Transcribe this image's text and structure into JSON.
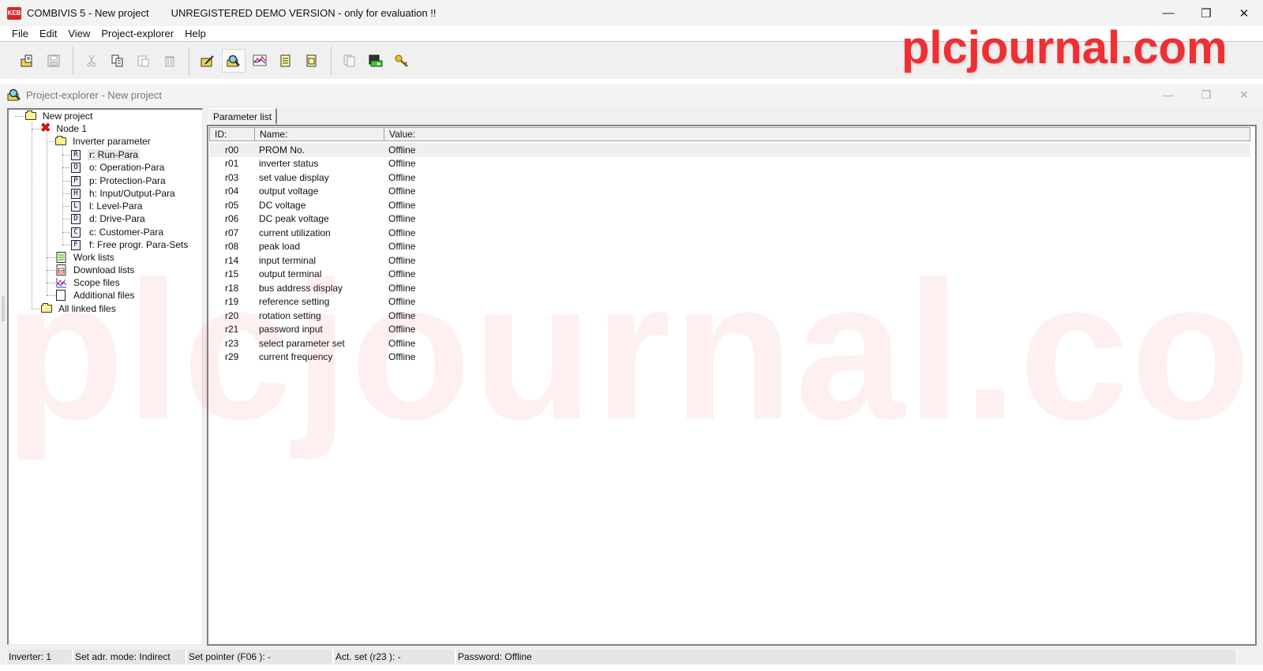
{
  "titlebar": {
    "logo": "KEB",
    "title": "COMBIVIS 5 - New project",
    "demo_notice": "UNREGISTERED DEMO VERSION - only for evaluation !!",
    "minimize": "—",
    "restore": "❐",
    "close": "✕"
  },
  "menu": [
    "File",
    "Edit",
    "View",
    "Project-explorer",
    "Help"
  ],
  "toolbar": {
    "buttons": [
      {
        "name": "open-project",
        "icon": "open-folder-icon",
        "enabled": true
      },
      {
        "name": "save",
        "icon": "floppy-icon",
        "enabled": false
      },
      {
        "name": "cut",
        "icon": "scissors-icon",
        "enabled": false
      },
      {
        "name": "copy",
        "icon": "copy-icon",
        "enabled": true
      },
      {
        "name": "paste",
        "icon": "paste-icon",
        "enabled": false
      },
      {
        "name": "delete",
        "icon": "trash-icon",
        "enabled": false
      },
      {
        "name": "edit-project",
        "icon": "edit-folder-icon",
        "enabled": true
      },
      {
        "name": "project-explorer",
        "icon": "magnifier-icon",
        "enabled": true,
        "active": true
      },
      {
        "name": "scope",
        "icon": "scope-chart-icon",
        "enabled": true
      },
      {
        "name": "work-list",
        "icon": "work-list-icon",
        "enabled": true
      },
      {
        "name": "download-list",
        "icon": "download-list-icon",
        "enabled": true
      },
      {
        "name": "document",
        "icon": "document-stack-icon",
        "enabled": false
      },
      {
        "name": "transfer",
        "icon": "transfer-icon",
        "enabled": true
      },
      {
        "name": "password",
        "icon": "key-icon",
        "enabled": true
      }
    ]
  },
  "watermark": "plcjournal.com",
  "child_window": {
    "title": "Project-explorer - New project",
    "minimize": "—",
    "restore": "❐",
    "close": "✕"
  },
  "tree": {
    "root": "New project",
    "node": "Node 1",
    "inverter_parameter": "Inverter parameter",
    "groups": [
      {
        "letter": "R",
        "label": "r: Run-Para",
        "selected": true
      },
      {
        "letter": "O",
        "label": "o: Operation-Para"
      },
      {
        "letter": "P",
        "label": "p: Protection-Para"
      },
      {
        "letter": "H",
        "label": "h: Input/Output-Para"
      },
      {
        "letter": "L",
        "label": "l: Level-Para"
      },
      {
        "letter": "D",
        "label": "d: Drive-Para"
      },
      {
        "letter": "C",
        "label": "c: Customer-Para"
      },
      {
        "letter": "F",
        "label": "f: Free progr. Para-Sets"
      }
    ],
    "work_lists": "Work lists",
    "download_lists": "Download lists",
    "scope_files": "Scope files",
    "additional_files": "Additional files",
    "all_linked_files": "All linked files"
  },
  "param_list": {
    "tab": "Parameter list",
    "columns": {
      "id": "ID:",
      "name": "Name:",
      "value": "Value:"
    },
    "rows": [
      {
        "id": "r00",
        "name": "PROM No.",
        "value": "Offline"
      },
      {
        "id": "r01",
        "name": "inverter status",
        "value": "Offline"
      },
      {
        "id": "r03",
        "name": "set value display",
        "value": "Offline"
      },
      {
        "id": "r04",
        "name": "output voltage",
        "value": "Offline"
      },
      {
        "id": "r05",
        "name": "DC voltage",
        "value": "Offline"
      },
      {
        "id": "r06",
        "name": "DC peak voltage",
        "value": "Offline"
      },
      {
        "id": "r07",
        "name": "current utilization",
        "value": "Offline"
      },
      {
        "id": "r08",
        "name": "peak load",
        "value": "Offline"
      },
      {
        "id": "r14",
        "name": "input terminal",
        "value": "Offline"
      },
      {
        "id": "r15",
        "name": "output terminal",
        "value": "Offline"
      },
      {
        "id": "r18",
        "name": "bus address display",
        "value": "Offline"
      },
      {
        "id": "r19",
        "name": "reference setting",
        "value": "Offline"
      },
      {
        "id": "r20",
        "name": "rotation setting",
        "value": "Offline"
      },
      {
        "id": "r21",
        "name": "password input",
        "value": "Offline"
      },
      {
        "id": "r23",
        "name": "select parameter set",
        "value": "Offline"
      },
      {
        "id": "r29",
        "name": "current frequency",
        "value": "Offline"
      }
    ]
  },
  "statusbar": {
    "inverter": "Inverter: 1",
    "adr_mode": "Set adr. mode: Indirect",
    "set_pointer": "Set pointer (F06 ):  -",
    "act_set": "Act. set (r23 ):  -",
    "password": "Password: Offline"
  }
}
